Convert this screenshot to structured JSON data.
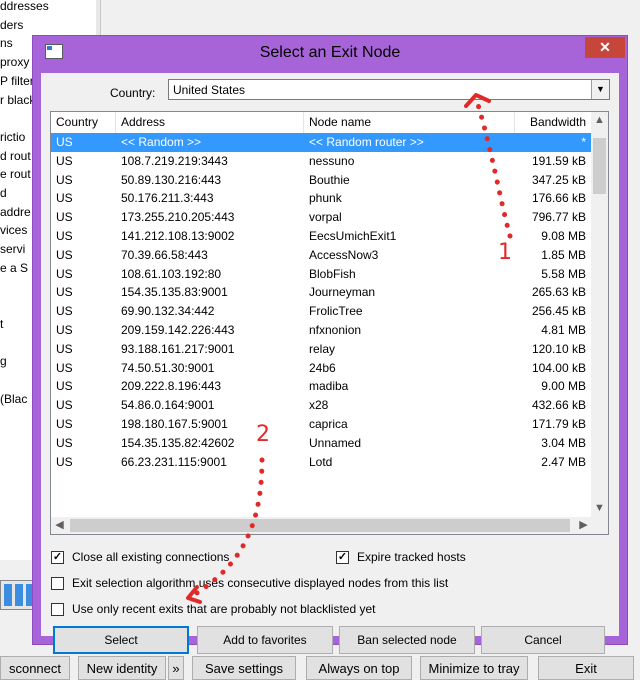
{
  "background": {
    "left_items": [
      "ddresses",
      "ders",
      "ns",
      " proxy",
      "P filter",
      "r black",
      "",
      "rictio",
      "d rout",
      "e rout",
      "d",
      "addre",
      "vices",
      " servi",
      "e a S",
      "",
      "",
      "t",
      "",
      "g",
      "",
      " (Blac"
    ],
    "buttons": [
      "sconnect",
      "New identity",
      "»",
      "Save settings",
      "Always on top",
      "Minimize to tray",
      "Exit"
    ]
  },
  "dialog": {
    "title": "Select an Exit Node",
    "close_glyph": "✕",
    "country_label": "Country:",
    "country_value": "United States",
    "columns": [
      "Country",
      "Address",
      "Node name",
      "Bandwidth"
    ],
    "rows": [
      {
        "country": "US",
        "address": "<< Random >>",
        "name": "<< Random router >>",
        "bandwidth": "*"
      },
      {
        "country": "US",
        "address": "108.7.219.219:3443",
        "name": "nessuno",
        "bandwidth": "191.59 kB"
      },
      {
        "country": "US",
        "address": "50.89.130.216:443",
        "name": "Bouthie",
        "bandwidth": "347.25 kB"
      },
      {
        "country": "US",
        "address": "50.176.211.3:443",
        "name": "phunk",
        "bandwidth": "176.66 kB"
      },
      {
        "country": "US",
        "address": "173.255.210.205:443",
        "name": "vorpal",
        "bandwidth": "796.77 kB"
      },
      {
        "country": "US",
        "address": "141.212.108.13:9002",
        "name": "EecsUmichExit1",
        "bandwidth": "9.08 MB"
      },
      {
        "country": "US",
        "address": "70.39.66.58:443",
        "name": "AccessNow3",
        "bandwidth": "1.85 MB"
      },
      {
        "country": "US",
        "address": "108.61.103.192:80",
        "name": "BlobFish",
        "bandwidth": "5.58 MB"
      },
      {
        "country": "US",
        "address": "154.35.135.83:9001",
        "name": "Journeyman",
        "bandwidth": "265.63 kB"
      },
      {
        "country": "US",
        "address": "69.90.132.34:442",
        "name": "FrolicTree",
        "bandwidth": "256.45 kB"
      },
      {
        "country": "US",
        "address": "209.159.142.226:443",
        "name": "nfxnonion",
        "bandwidth": "4.81 MB"
      },
      {
        "country": "US",
        "address": "93.188.161.217:9001",
        "name": "relay",
        "bandwidth": "120.10 kB"
      },
      {
        "country": "US",
        "address": "74.50.51.30:9001",
        "name": "24b6",
        "bandwidth": "104.00 kB"
      },
      {
        "country": "US",
        "address": "209.222.8.196:443",
        "name": "madiba",
        "bandwidth": "9.00 MB"
      },
      {
        "country": "US",
        "address": "54.86.0.164:9001",
        "name": "x28",
        "bandwidth": "432.66 kB"
      },
      {
        "country": "US",
        "address": "198.180.167.5:9001",
        "name": "caprica",
        "bandwidth": "171.79 kB"
      },
      {
        "country": "US",
        "address": "154.35.135.82:42602",
        "name": "Unnamed",
        "bandwidth": "3.04 MB"
      },
      {
        "country": "US",
        "address": "66.23.231.115:9001",
        "name": "Lotd",
        "bandwidth": "2.47 MB"
      }
    ],
    "options": [
      {
        "label": "Close all existing connections",
        "checked": true
      },
      {
        "label": "Expire tracked hosts",
        "checked": true
      },
      {
        "label": "Exit selection algorithm uses consecutive displayed nodes from this list",
        "checked": false
      },
      {
        "label": "Use only recent exits that are probably not blacklisted yet",
        "checked": false
      }
    ],
    "check_glyph": "✓",
    "buttons": {
      "select": "Select",
      "favorites": "Add to favorites",
      "ban": "Ban selected node",
      "cancel": "Cancel"
    }
  },
  "annotations": {
    "labels": [
      "1",
      "2"
    ],
    "color": "#e02a2a"
  },
  "colors": {
    "titlebar": "#a764d8",
    "selection": "#3399ff",
    "close": "#c7463a"
  }
}
